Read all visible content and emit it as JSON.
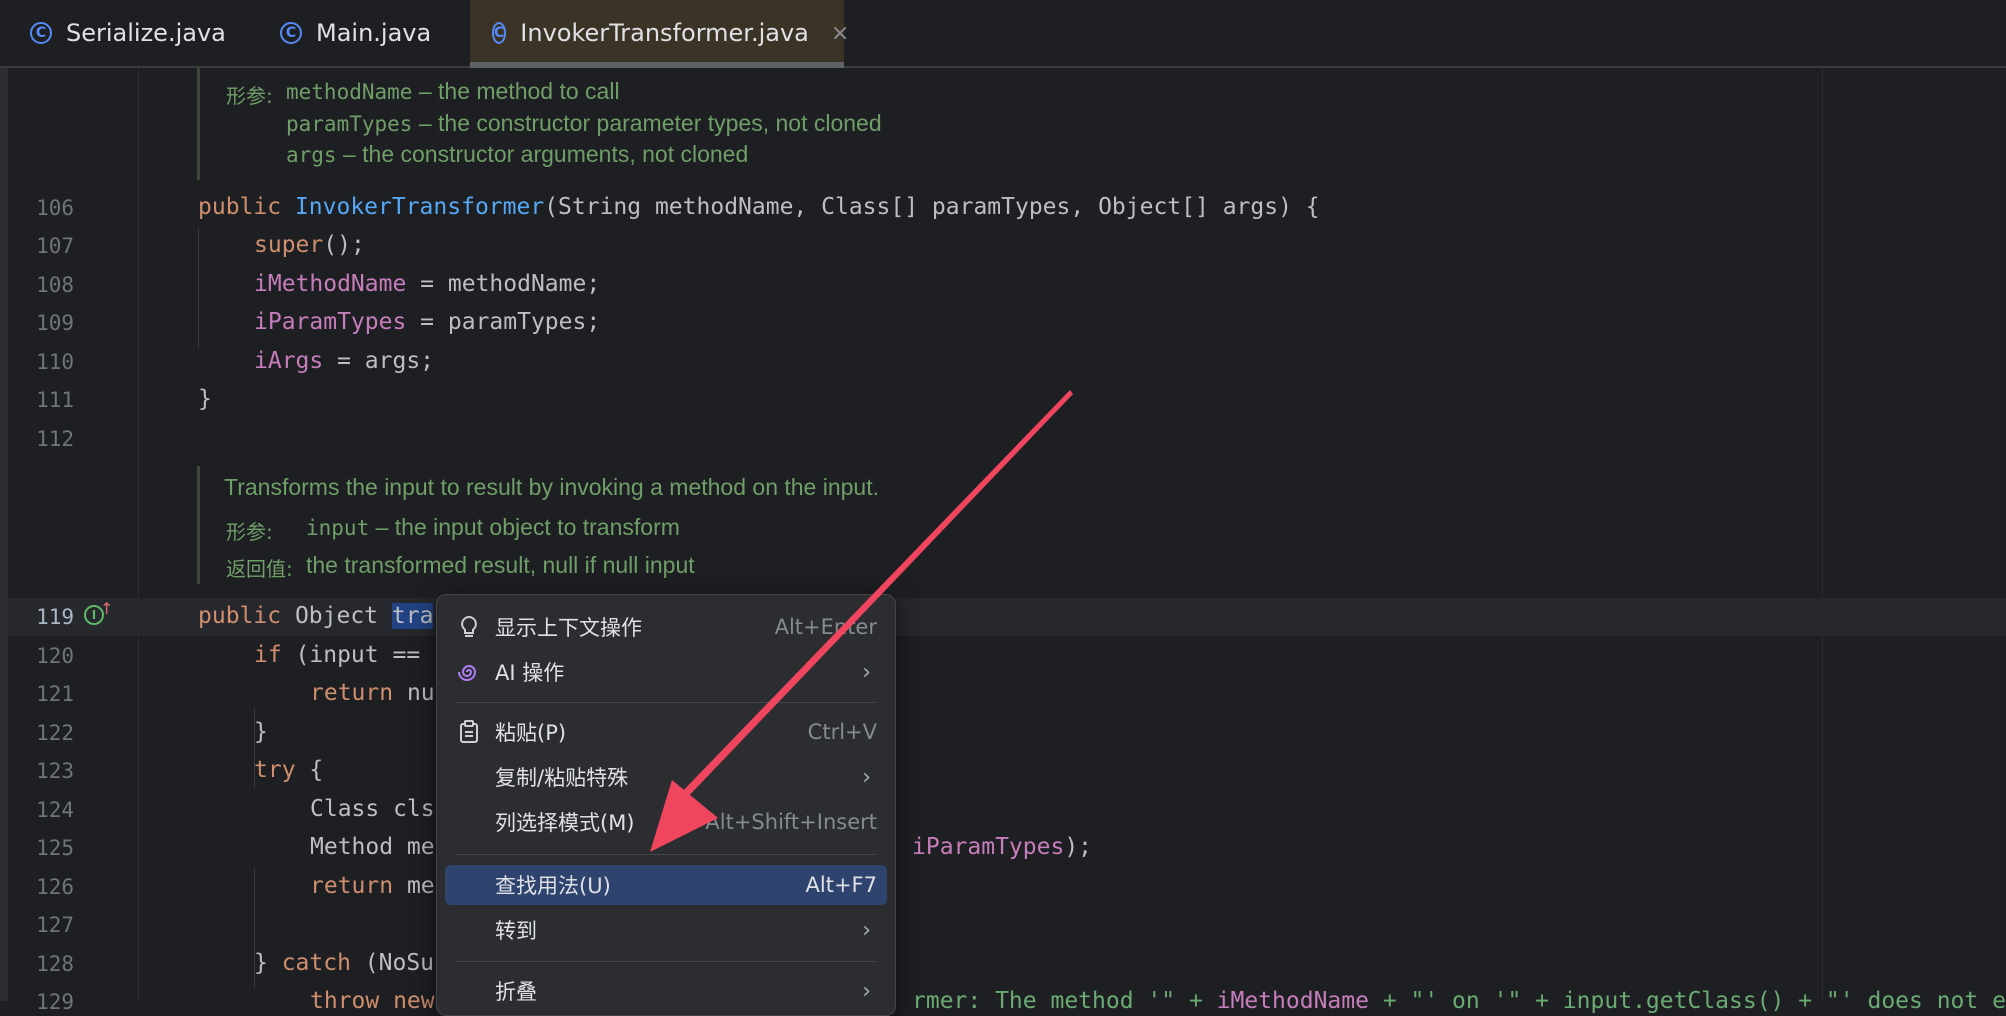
{
  "tabs": [
    {
      "label": "Serialize.java",
      "active": false
    },
    {
      "label": "Main.java",
      "active": false
    },
    {
      "label": "InvokerTransformer.java",
      "active": true
    }
  ],
  "tab_close": "×",
  "doc1": {
    "label": "形参:",
    "params": [
      {
        "name": "methodName",
        "desc": " – the method to call"
      },
      {
        "name": "paramTypes",
        "desc": " – the constructor parameter types, not cloned"
      },
      {
        "name": "args",
        "desc": " – the constructor arguments, not cloned"
      }
    ]
  },
  "doc2": {
    "summary": "Transforms the input to result by invoking a method on the input.",
    "param_label": "形参:",
    "param_name": "input",
    "param_desc": " – the input object to transform",
    "return_label": "返回值:",
    "return_desc": "the transformed result, null if null input"
  },
  "line_numbers": [
    "106",
    "107",
    "108",
    "109",
    "110",
    "111",
    "112",
    "119",
    "120",
    "121",
    "122",
    "123",
    "124",
    "125",
    "126",
    "127",
    "128",
    "129"
  ],
  "code": {
    "l106": {
      "kw": "public ",
      "fn": "InvokerTransformer",
      "rest": "(String methodName, Class[] paramTypes, Object[] args) {"
    },
    "l107": {
      "kw": "super",
      "rest": "();"
    },
    "l108": {
      "fld": "iMethodName",
      "rest": " = methodName;"
    },
    "l109": {
      "fld": "iParamTypes",
      "rest": " = paramTypes;"
    },
    "l110": {
      "fld": "iArgs",
      "rest": " = args;"
    },
    "l111": "}",
    "l119": {
      "kw": "public ",
      "rest": "Object ",
      "sel": "tra"
    },
    "l120": {
      "kw": "if ",
      "rest": "(input == "
    },
    "l121": {
      "kw": "return ",
      "rest": "nu"
    },
    "l122": "}",
    "l123": {
      "kw": "try ",
      "rest": "{"
    },
    "l124": "Class cls",
    "l125": {
      "left": "Method me",
      "fld": "iParamTypes",
      "right": ");"
    },
    "l126": {
      "kw": "return ",
      "rest": "me"
    },
    "l128": {
      "left": "} ",
      "kw": "catch ",
      "rest": "(NoSu"
    },
    "l129": {
      "kw": "throw new",
      "str1": "rmer: The method '\" + ",
      "fld": "iMethodName",
      "str2": " + \"' on '\" + input.getClass() + \"' does not e"
    }
  },
  "context_menu": {
    "items": [
      {
        "icon": "lightbulb-icon",
        "label": "显示上下文操作",
        "shortcut": "Alt+Enter"
      },
      {
        "icon": "ai-spiral-icon",
        "label": "AI 操作",
        "submenu": "›"
      },
      {
        "icon": "clipboard-icon",
        "label": "粘贴(P)",
        "shortcut": "Ctrl+V"
      },
      {
        "label": "复制/粘贴特殊",
        "submenu": "›"
      },
      {
        "label": "列选择模式(M)",
        "shortcut": "Alt+Shift+Insert"
      },
      {
        "label": "查找用法(U)",
        "shortcut": "Alt+F7",
        "highlighted": true
      },
      {
        "label": "转到",
        "submenu": "›"
      },
      {
        "label": "折叠",
        "submenu": "›"
      }
    ]
  },
  "annotation_color": "#f0455f",
  "accent_color": "#548af7"
}
